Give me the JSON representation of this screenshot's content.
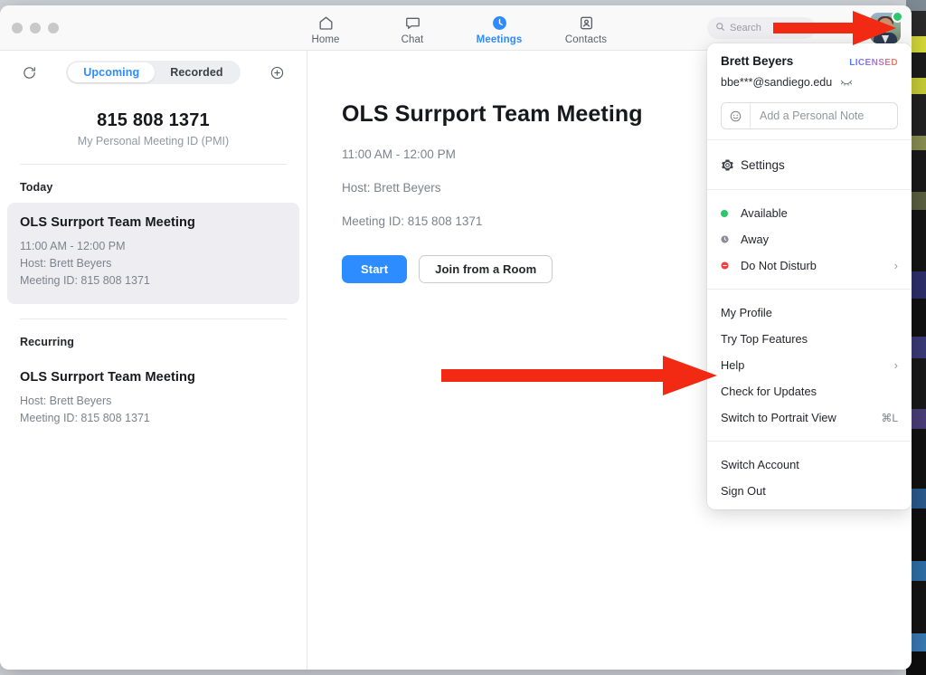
{
  "window": {
    "traffic_lights": [
      "close",
      "minimize",
      "zoom"
    ]
  },
  "top_nav": {
    "items": [
      {
        "label": "Home",
        "icon": "home-icon",
        "active": false
      },
      {
        "label": "Chat",
        "icon": "chat-bubble-icon",
        "active": false
      },
      {
        "label": "Meetings",
        "icon": "clock-icon",
        "active": true
      },
      {
        "label": "Contacts",
        "icon": "contact-card-icon",
        "active": false
      }
    ],
    "active_accent": "#2d8cff"
  },
  "search": {
    "placeholder": "Search",
    "icon": "search-icon"
  },
  "avatar": {
    "name": "avatar",
    "status": "available",
    "status_color": "#2bc86a"
  },
  "sidebar": {
    "refresh_icon": "refresh-icon",
    "add_icon": "plus-circle-icon",
    "tabs": [
      {
        "label": "Upcoming",
        "active": true
      },
      {
        "label": "Recorded",
        "active": false
      }
    ],
    "pmi": {
      "number": "815 808 1371",
      "label": "My Personal Meeting ID (PMI)"
    },
    "sections": [
      {
        "heading": "Today",
        "meetings": [
          {
            "title": "OLS Surrport Team Meeting",
            "time": "11:00 AM - 12:00 PM",
            "host": "Host: Brett Beyers",
            "meeting_id": "Meeting ID: 815 808 1371",
            "selected": true
          }
        ]
      },
      {
        "heading": "Recurring",
        "meetings": [
          {
            "title": "OLS Surrport Team Meeting",
            "time": "",
            "host": "Host: Brett Beyers",
            "meeting_id": "Meeting ID: 815 808 1371",
            "selected": false
          }
        ]
      }
    ]
  },
  "detail": {
    "title": "OLS Surrport Team Meeting",
    "time": "11:00 AM - 12:00 PM",
    "host": "Host: Brett Beyers",
    "meeting_id": "Meeting ID: 815 808 1371",
    "start_button": "Start",
    "join_room_button": "Join from a Room"
  },
  "profile_menu": {
    "name": "Brett Beyers",
    "license_badge": "LICENSED",
    "email": "bbe***@sandiego.edu",
    "email_toggle_icon": "eye-hidden-icon",
    "note_placeholder": "Add a Personal Note",
    "note_icon": "smiley-icon",
    "settings": {
      "label": "Settings",
      "icon": "gear-icon"
    },
    "statuses": [
      {
        "label": "Available",
        "icon": "status-available-icon",
        "color": "#2bc86a",
        "has_chevron": false
      },
      {
        "label": "Away",
        "icon": "status-away-icon",
        "color": "#8a8d99",
        "has_chevron": false
      },
      {
        "label": "Do Not Disturb",
        "icon": "status-dnd-icon",
        "color": "#f04141",
        "has_chevron": true
      }
    ],
    "items": [
      {
        "label": "My Profile",
        "shortcut": "",
        "has_chevron": false
      },
      {
        "label": "Try Top Features",
        "shortcut": "",
        "has_chevron": false
      },
      {
        "label": "Help",
        "shortcut": "",
        "has_chevron": true
      },
      {
        "label": "Check for Updates",
        "shortcut": "",
        "has_chevron": false
      },
      {
        "label": "Switch to Portrait View",
        "shortcut": "⌘L",
        "has_chevron": false
      }
    ],
    "account_items": [
      {
        "label": "Switch Account"
      },
      {
        "label": "Sign Out"
      }
    ]
  },
  "annotations": {
    "arrow_color": "#f22a14",
    "arrows": [
      {
        "name": "arrow-to-avatar",
        "target": "avatar"
      },
      {
        "name": "arrow-to-check-for-updates",
        "target": "Check for Updates"
      }
    ]
  }
}
